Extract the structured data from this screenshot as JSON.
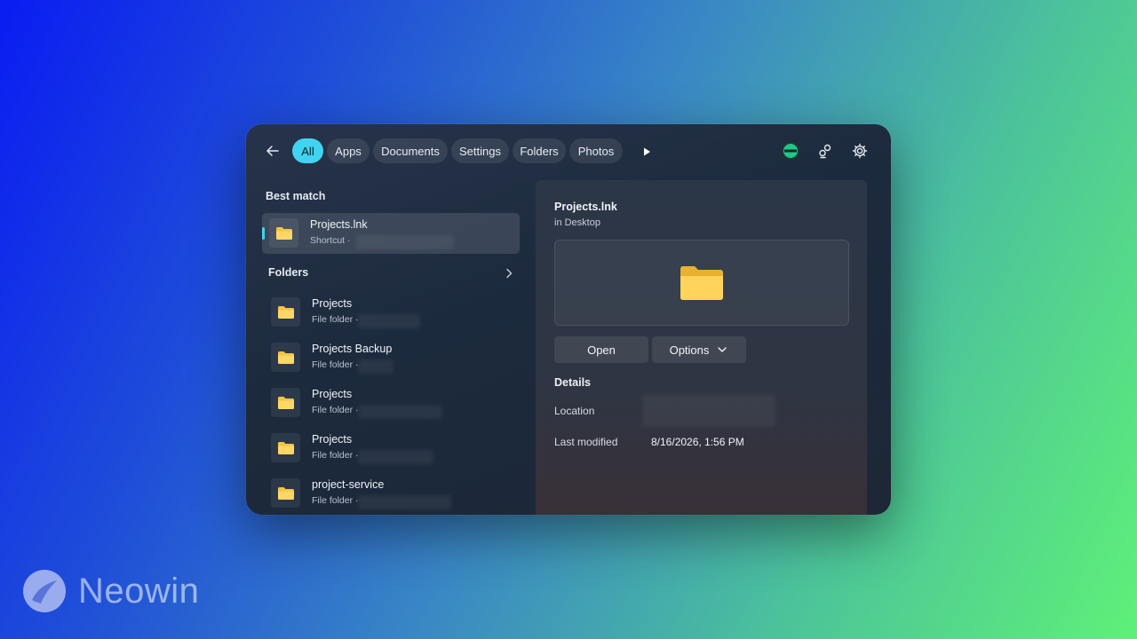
{
  "tabs": [
    {
      "label": "All",
      "active": true
    },
    {
      "label": "Apps"
    },
    {
      "label": "Documents"
    },
    {
      "label": "Settings"
    },
    {
      "label": "Folders"
    },
    {
      "label": "Photos"
    }
  ],
  "best_match": {
    "heading": "Best match",
    "item": {
      "name": "Projects.lnk",
      "sub": "Shortcut ·"
    }
  },
  "folders": {
    "heading": "Folders",
    "items": [
      {
        "name": "Projects",
        "sub": "File folder ·"
      },
      {
        "name": "Projects Backup",
        "sub": "File folder ·"
      },
      {
        "name": "Projects",
        "sub": "File folder ·"
      },
      {
        "name": "Projects",
        "sub": "File folder ·"
      },
      {
        "name": "project-service",
        "sub": "File folder ·"
      }
    ]
  },
  "preview": {
    "title": "Projects.lnk",
    "location_line": "in Desktop",
    "open_label": "Open",
    "options_label": "Options",
    "details_heading": "Details",
    "location_label": "Location",
    "modified_label": "Last modified",
    "modified_value": "8/16/2026, 1:56 PM"
  },
  "brand": {
    "name": "Neowin"
  },
  "colors": {
    "accent": "#40d4f0",
    "folder": "#f5c443"
  }
}
